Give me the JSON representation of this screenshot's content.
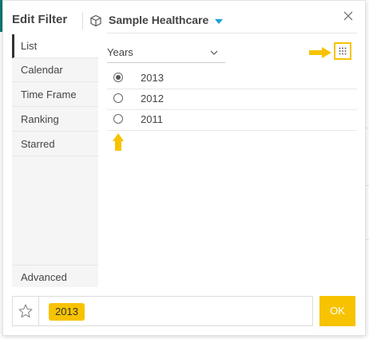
{
  "header": {
    "title": "Edit Filter",
    "dataset": "Sample Healthcare"
  },
  "sidebar": {
    "items": [
      {
        "label": "List",
        "active": true
      },
      {
        "label": "Calendar"
      },
      {
        "label": "Time Frame"
      },
      {
        "label": "Ranking"
      },
      {
        "label": "Starred"
      }
    ],
    "advanced_label": "Advanced"
  },
  "main": {
    "level_select": "Years",
    "options": [
      {
        "label": "2013",
        "selected": true
      },
      {
        "label": "2012",
        "selected": false
      },
      {
        "label": "2011",
        "selected": false
      }
    ]
  },
  "footer": {
    "selected_chip": "2013",
    "ok_label": "OK"
  },
  "colors": {
    "accent": "#f7c300",
    "caret": "#1a9fd6",
    "annotation_arrows": "#f7c300"
  },
  "icons": [
    "cube-icon",
    "caret-down-icon",
    "close-icon",
    "chevron-down-icon",
    "grid-dots-icon",
    "star-icon",
    "arrow-right-icon",
    "arrow-up-icon"
  ]
}
